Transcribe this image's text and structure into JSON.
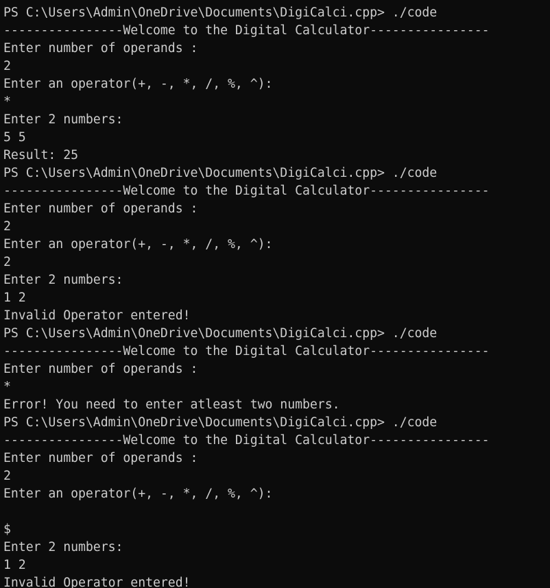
{
  "terminal": {
    "lines": [
      "PS C:\\Users\\Admin\\OneDrive\\Documents\\DigiCalci.cpp> ./code",
      "----------------Welcome to the Digital Calculator----------------",
      "Enter number of operands :",
      "2",
      "Enter an operator(+, -, *, /, %, ^):",
      "*",
      "Enter 2 numbers:",
      "5 5",
      "Result: 25",
      "PS C:\\Users\\Admin\\OneDrive\\Documents\\DigiCalci.cpp> ./code",
      "----------------Welcome to the Digital Calculator----------------",
      "Enter number of operands :",
      "2",
      "Enter an operator(+, -, *, /, %, ^):",
      "2",
      "Enter 2 numbers:",
      "1 2",
      "Invalid Operator entered!",
      "PS C:\\Users\\Admin\\OneDrive\\Documents\\DigiCalci.cpp> ./code",
      "----------------Welcome to the Digital Calculator----------------",
      "Enter number of operands :",
      "*",
      "Error! You need to enter atleast two numbers.",
      "PS C:\\Users\\Admin\\OneDrive\\Documents\\DigiCalci.cpp> ./code",
      "----------------Welcome to the Digital Calculator----------------",
      "Enter number of operands :",
      "2",
      "Enter an operator(+, -, *, /, %, ^):",
      "",
      "$",
      "Enter 2 numbers:",
      "1 2",
      "Invalid Operator entered!"
    ]
  },
  "colors": {
    "background": "#0c0c0c",
    "foreground": "#cccccc"
  }
}
